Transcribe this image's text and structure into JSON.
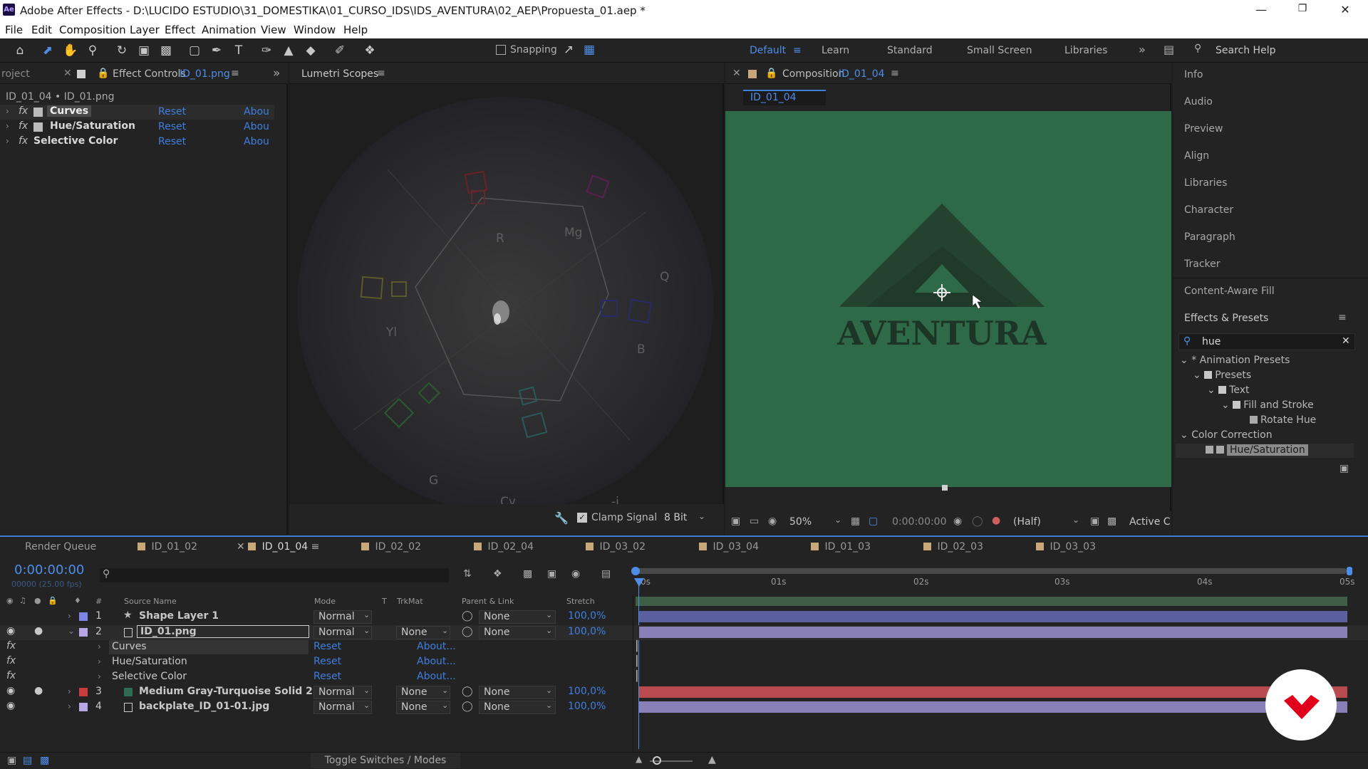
{
  "app": {
    "logo": "Ae",
    "title": "Adobe After Effects - D:\\LUCIDO ESTUDIO\\31_DOMESTIKA\\01_CURSO_IDS\\IDS_AVENTURA\\02_AEP\\Propuesta_01.aep *"
  },
  "menu": [
    "File",
    "Edit",
    "Composition",
    "Layer",
    "Effect",
    "Animation",
    "View",
    "Window",
    "Help"
  ],
  "toolbar": {
    "snapping": "Snapping"
  },
  "workspaces": {
    "default": "Default",
    "learn": "Learn",
    "standard": "Standard",
    "small": "Small Screen",
    "libraries": "Libraries"
  },
  "search": {
    "placeholder": "Search Help"
  },
  "left": {
    "project_tab": "roject",
    "effect_tab": "Effect Controls",
    "effect_tab_target": "ID_01.png",
    "breadcrumb": "ID_01_04 • ID_01.png",
    "effects": [
      {
        "name": "Curves",
        "reset": "Reset",
        "about": "Abou"
      },
      {
        "name": "Hue/Saturation",
        "reset": "Reset",
        "about": "Abou"
      },
      {
        "name": "Selective Color",
        "reset": "Reset",
        "about": "Abou"
      }
    ]
  },
  "scopes": {
    "tab": "Lumetri Scopes",
    "labels": {
      "r": "R",
      "mg": "Mg",
      "q": "Q",
      "yl": "Yl",
      "b": "B",
      "g": "G",
      "cy": "Cy",
      "i": "-i"
    },
    "clamp": "Clamp Signal",
    "bit": "8 Bit"
  },
  "comp": {
    "tab": "Composition",
    "tab_target": "ID_01_04",
    "subtab": "ID_01_04",
    "title_text": "AVENTURA",
    "zoom": "50%",
    "time": "0:00:00:00",
    "quality": "(Half)",
    "active": "Active C",
    "bg_color": "#2e6a47"
  },
  "right": {
    "items": [
      "Info",
      "Audio",
      "Preview",
      "Align",
      "Libraries",
      "Character",
      "Paragraph",
      "Tracker",
      "Content-Aware Fill"
    ],
    "effects_presets": "Effects & Presets",
    "search_value": "hue",
    "tree": [
      {
        "label": "* Animation Presets",
        "indent": 0
      },
      {
        "label": "Presets",
        "indent": 1
      },
      {
        "label": "Text",
        "indent": 2
      },
      {
        "label": "Fill and Stroke",
        "indent": 3
      },
      {
        "label": "Rotate Hue",
        "indent": 4
      },
      {
        "label": "Color Correction",
        "indent": 0
      },
      {
        "label": "Hue/Saturation",
        "indent": 2
      }
    ]
  },
  "timeline": {
    "tabs": [
      {
        "label": "Render Queue",
        "color": ""
      },
      {
        "label": "ID_01_02",
        "color": "#c8a878"
      },
      {
        "label": "ID_01_04",
        "color": "#c8a878",
        "active": true
      },
      {
        "label": "ID_02_02",
        "color": "#c8a878"
      },
      {
        "label": "ID_02_04",
        "color": "#c8a878"
      },
      {
        "label": "ID_03_02",
        "color": "#c8a878"
      },
      {
        "label": "ID_03_04",
        "color": "#c8a878"
      },
      {
        "label": "ID_01_03",
        "color": "#c8a878"
      },
      {
        "label": "ID_02_03",
        "color": "#c8a878"
      },
      {
        "label": "ID_03_03",
        "color": "#c8a878"
      }
    ],
    "timecode": "0:00:00:00",
    "fps": "00000 (25.00 fps)",
    "headers": {
      "num": "#",
      "source": "Source Name",
      "mode": "Mode",
      "t": "T",
      "trkmat": "TrkMat",
      "parent": "Parent & Link",
      "stretch": "Stretch"
    },
    "ruler": [
      "0s",
      "01s",
      "02s",
      "03s",
      "04s",
      "05s"
    ],
    "layers": [
      {
        "num": "1",
        "name": "Shape Layer 1",
        "mode": "Normal",
        "trkmat": "",
        "parent": "None",
        "stretch": "100,0%",
        "color": "#7d85e8",
        "bar": "#5a5f9e"
      },
      {
        "num": "2",
        "name": "ID_01.png",
        "mode": "Normal",
        "trkmat": "None",
        "parent": "None",
        "stretch": "100,0%",
        "color": "#b8a6e6",
        "bar": "#8a80b8"
      },
      {
        "num": "3",
        "name": "Medium Gray-Turquoise Solid 2",
        "mode": "Normal",
        "trkmat": "None",
        "parent": "None",
        "stretch": "100,0%",
        "color": "#c83c3c",
        "bar": "#b84a50"
      },
      {
        "num": "4",
        "name": "backplate_ID_01-01.jpg",
        "mode": "Normal",
        "trkmat": "None",
        "parent": "None",
        "stretch": "100,0%",
        "color": "#b8a6e6",
        "bar": "#8a80b8"
      }
    ],
    "sub_effects": [
      {
        "name": "Curves",
        "reset": "Reset",
        "about": "About..."
      },
      {
        "name": "Hue/Saturation",
        "reset": "Reset",
        "about": "About..."
      },
      {
        "name": "Selective Color",
        "reset": "Reset",
        "about": "About..."
      }
    ],
    "toggle": "Toggle Switches / Modes"
  }
}
